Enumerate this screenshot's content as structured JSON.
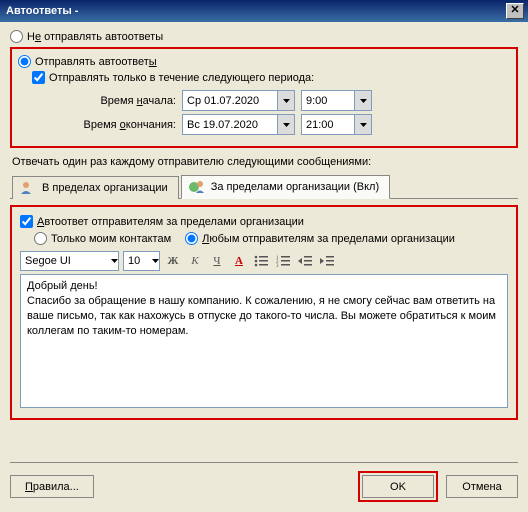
{
  "titlebar": {
    "title": "Автоответы -"
  },
  "top": {
    "dont_send_label": "Не отправлять автоответы",
    "send_label": "Отправлять автоответы",
    "period_check_label": "Отправлять только в течение следующего периода:",
    "start_label": "Время начала:",
    "end_label": "Время окончания:",
    "start_date": "Ср 01.07.2020",
    "start_time": "9:00",
    "end_date": "Вс 19.07.2020",
    "end_time": "21:00"
  },
  "reply_note": "Отвечать один раз каждому отправителю следующими сообщениями:",
  "tabs": {
    "inside": "В пределах организации",
    "outside": "За пределами организации (Вкл)"
  },
  "external": {
    "checkbox_label": "Автоответ отправителям за пределами организации",
    "contacts_only": "Только моим контактам",
    "any_sender": "Любым отправителям за пределами организации",
    "font_name": "Segoe UI",
    "font_size": "10",
    "greeting": "Добрый день!",
    "body": "Спасибо за обращение в нашу компанию. К сожалению, я не смогу сейчас вам ответить на ваше письмо, так как нахожусь в отпуске до такого-то числа. Вы можете обратиться к моим коллегам по таким-то номерам."
  },
  "footer": {
    "rules": "Правила...",
    "ok": "OK",
    "cancel": "Отмена"
  },
  "toolbar_glyphs": {
    "bold": "Ж",
    "italic": "К",
    "underline": "Ч"
  }
}
